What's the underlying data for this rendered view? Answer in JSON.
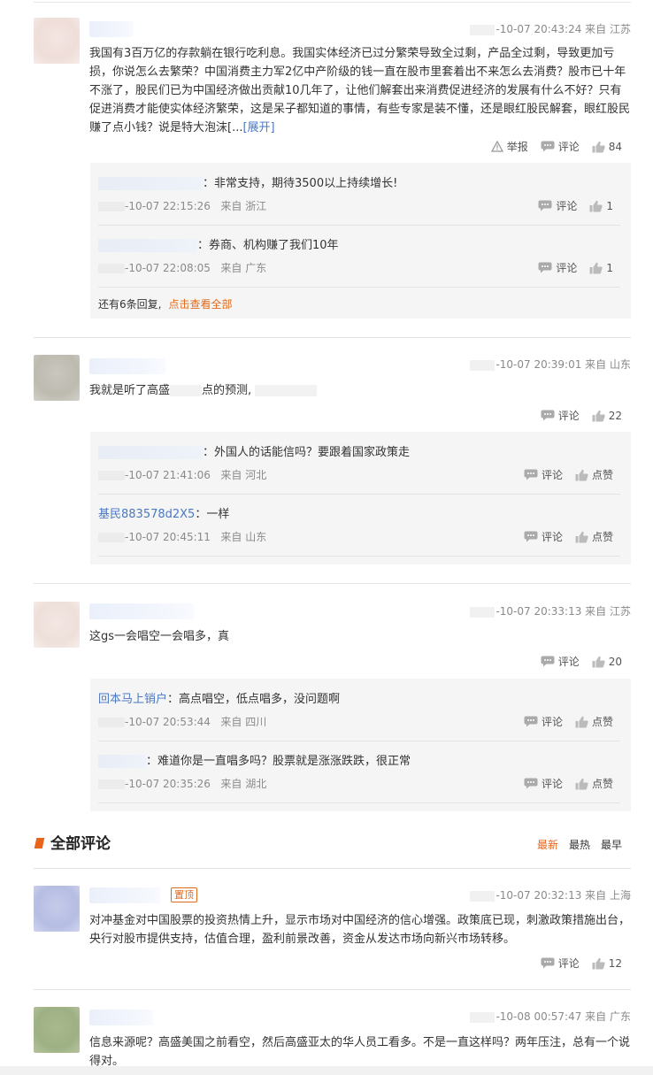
{
  "comments": [
    {
      "meta": "-10-07 20:43:24 来自 江苏",
      "text": "我国有3百万亿的存款躺在银行吃利息。我国实体经济已过分繁荣导致全过剩，产品全过剩，导致更加亏损，你说怎么去繁荣？中国消费主力军2亿中产阶级的钱一直在股市里套着出不来怎么去消费？股市已十年不涨了，股民们已为中国经济做出贡献10几年了，让他们解套出来消费促进经济的发展有什么不好？只有促进消费才能使实体经济繁荣，这是呆子都知道的事情，有些专家是装不懂，还是眼红股民解套，眼红股民赚了点小钱？说是特大泡沫[...",
      "expand": "[展开]",
      "report": "举报",
      "comment": "评论",
      "likes": "84",
      "replies": [
        {
          "name": "",
          "text": "：非常支持，期待3500以上持续增长!",
          "date": "-10-07 22:15:26",
          "loc": "来自 浙江",
          "comment": "评论",
          "likes": "1"
        },
        {
          "name": "",
          "text": "：券商、机构赚了我们10年",
          "date": "-10-07 22:08:05",
          "loc": "来自 广东",
          "comment": "评论",
          "likes": "1"
        }
      ],
      "more_text": "还有6条回复,",
      "more_link": "点击查看全部"
    },
    {
      "meta": "-10-07 20:39:01 来自 山东",
      "text_a": "我就是听了高盛",
      "text_b": "点的预测,",
      "comment": "评论",
      "likes": "22",
      "replies": [
        {
          "name": "",
          "text": "：外国人的话能信吗？要跟着国家政策走",
          "date": "-10-07 21:41:06",
          "loc": "来自 河北",
          "comment": "评论",
          "likes": "点赞"
        },
        {
          "name": "基民883578d2X5",
          "text": "：一样",
          "date": "-10-07 20:45:11",
          "loc": "来自 山东",
          "comment": "评论",
          "likes": "点赞"
        }
      ]
    },
    {
      "meta": "-10-07 20:33:13 来自 江苏",
      "text": "这gs一会唱空一会唱多，真",
      "comment": "评论",
      "likes": "20",
      "replies": [
        {
          "name": "回本马上销户",
          "text": "：高点唱空，低点唱多，没问题啊",
          "date": "-10-07 20:53:44",
          "loc": "来自 四川",
          "comment": "评论",
          "likes": "点赞"
        },
        {
          "name": "",
          "text": "：难道你是一直唱多吗？股票就是涨涨跌跌，很正常",
          "date": "-10-07 20:35:26",
          "loc": "来自 湖北",
          "comment": "评论",
          "likes": "点赞"
        }
      ]
    }
  ],
  "section": {
    "title": "全部评论",
    "sorts": [
      "最新",
      "最热",
      "最早"
    ]
  },
  "all_comments": [
    {
      "pin": "置顶",
      "meta": "-10-07 20:32:13 来自 上海",
      "text": "对冲基金对中国股票的投资热情上升，显示市场对中国经济的信心增强。政策底已现，刺激政策措施出台，央行对股市提供支持，估值合理，盈利前景改善，资金从发达市场向新兴市场转移。",
      "comment": "评论",
      "likes": "12"
    },
    {
      "meta": "-10-08 00:57:47 来自 广东",
      "text": "信息来源呢？高盛美国之前看空，然后高盛亚太的华人员工看多。不是一直这样吗？两年压注，总有一个说得对。"
    }
  ],
  "colors": {
    "accent": "#e8641b",
    "link": "#4a78c2",
    "reply_bg": "#f5f5f5"
  }
}
